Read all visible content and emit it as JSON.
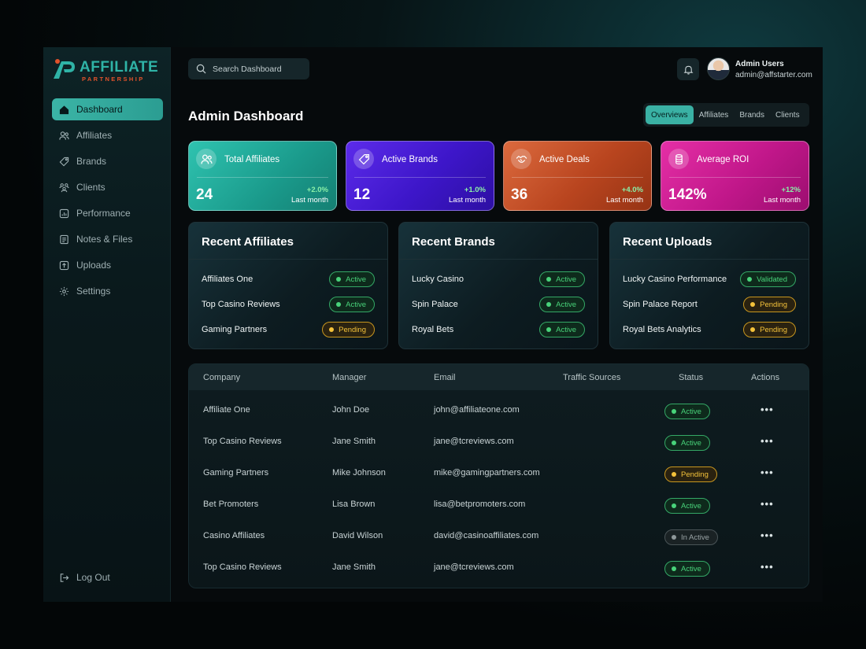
{
  "brand": {
    "name": "AFFILIATE",
    "tagline": "PARTNERSHIP",
    "accent": "#2fb3a6",
    "secondary": "#e0522b"
  },
  "sidebar": {
    "items": [
      {
        "label": "Dashboard",
        "icon": "home-icon",
        "active": true
      },
      {
        "label": "Affiliates",
        "icon": "users-icon"
      },
      {
        "label": "Brands",
        "icon": "tag-icon"
      },
      {
        "label": "Clients",
        "icon": "people-group-icon"
      },
      {
        "label": "Performance",
        "icon": "chart-icon"
      },
      {
        "label": "Notes & Files",
        "icon": "file-icon"
      },
      {
        "label": "Uploads",
        "icon": "upload-icon"
      },
      {
        "label": "Settings",
        "icon": "gear-icon"
      }
    ],
    "logout_label": "Log Out"
  },
  "topbar": {
    "search_placeholder": "Search Dashboard",
    "user": {
      "name": "Admin Users",
      "email": "admin@affstarter.com"
    }
  },
  "page": {
    "title": "Admin Dashboard",
    "tabs": [
      "Overviews",
      "Affiliates",
      "Brands",
      "Clients"
    ],
    "active_tab": "Overviews"
  },
  "stats": [
    {
      "label": "Total Affiliates",
      "value": "24",
      "change": "+2.0%",
      "period": "Last month",
      "icon": "users-icon",
      "color": "#1fa596"
    },
    {
      "label": "Active Brands",
      "value": "12",
      "change": "+1.0%",
      "period": "Last month",
      "icon": "tag-icon",
      "color": "#4a1fd0"
    },
    {
      "label": "Active Deals",
      "value": "36",
      "change": "+4.0%",
      "period": "Last month",
      "icon": "handshake-icon",
      "color": "#c24a24"
    },
    {
      "label": "Average ROI",
      "value": "142%",
      "change": "+12%",
      "period": "Last month",
      "icon": "coins-icon",
      "color": "#c01a8c"
    }
  ],
  "cards": [
    {
      "title": "Recent Affiliates",
      "rows": [
        {
          "name": "Affiliates One",
          "status": "Active",
          "kind": "active"
        },
        {
          "name": "Top Casino Reviews",
          "status": "Active",
          "kind": "active"
        },
        {
          "name": "Gaming Partners",
          "status": "Pending",
          "kind": "pending"
        }
      ]
    },
    {
      "title": "Recent Brands",
      "rows": [
        {
          "name": "Lucky Casino",
          "status": "Active",
          "kind": "active"
        },
        {
          "name": "Spin Palace",
          "status": "Active",
          "kind": "active"
        },
        {
          "name": "Royal Bets",
          "status": "Active",
          "kind": "active"
        }
      ]
    },
    {
      "title": "Recent Uploads",
      "rows": [
        {
          "name": "Lucky Casino Performance",
          "status": "Validated",
          "kind": "active"
        },
        {
          "name": "Spin Palace Report",
          "status": "Pending",
          "kind": "pending"
        },
        {
          "name": "Royal Bets Analytics",
          "status": "Pending",
          "kind": "pending"
        }
      ]
    }
  ],
  "table": {
    "columns": [
      "Company",
      "Manager",
      "Email",
      "Traffic Sources",
      "Status",
      "Actions"
    ],
    "rows": [
      {
        "company": "Affiliate One",
        "manager": "John Doe",
        "email": "john@affiliateone.com",
        "status": "Active",
        "kind": "active"
      },
      {
        "company": "Top Casino Reviews",
        "manager": "Jane Smith",
        "email": "jane@tcreviews.com",
        "status": "Active",
        "kind": "active"
      },
      {
        "company": "Gaming Partners",
        "manager": "Mike Johnson",
        "email": "mike@gamingpartners.com",
        "status": "Pending",
        "kind": "pending"
      },
      {
        "company": "Bet Promoters",
        "manager": "Lisa Brown",
        "email": "lisa@betpromoters.com",
        "status": "Active",
        "kind": "active"
      },
      {
        "company": "Casino Affiliates",
        "manager": "David Wilson",
        "email": "david@casinoaffiliates.com",
        "status": "In Active",
        "kind": "inactive"
      },
      {
        "company": "Top Casino Reviews",
        "manager": "Jane Smith",
        "email": "jane@tcreviews.com",
        "status": "Active",
        "kind": "active"
      }
    ],
    "actions_glyph": "•••"
  }
}
